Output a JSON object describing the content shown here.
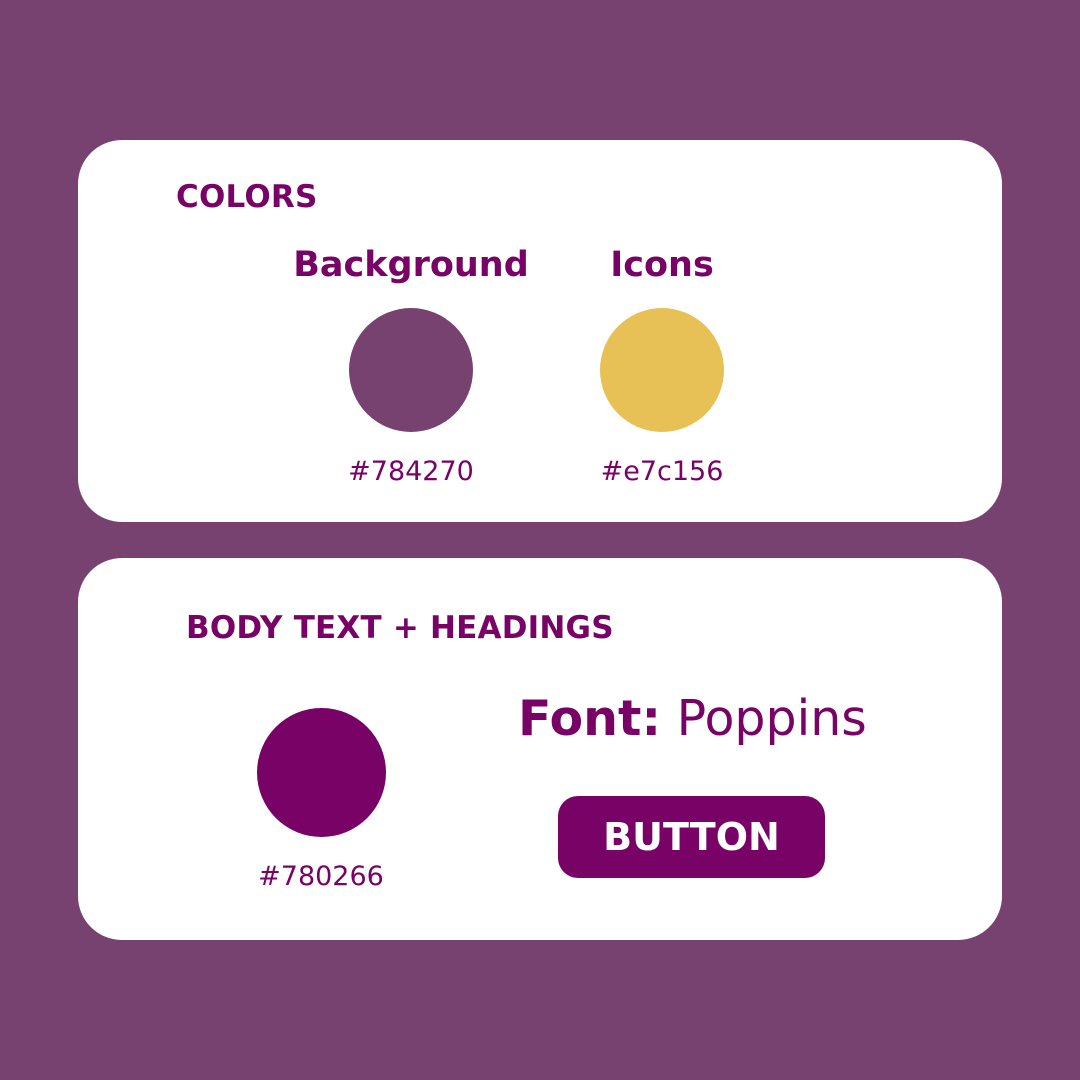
{
  "colors": {
    "title": "COLORS",
    "swatches": [
      {
        "label": "Background",
        "hex": "#784270",
        "color": "#784270"
      },
      {
        "label": "Icons",
        "hex": "#e7c156",
        "color": "#e7c156"
      }
    ]
  },
  "typography": {
    "title": "BODY TEXT + HEADINGS",
    "swatch": {
      "hex": "#780266",
      "color": "#780266"
    },
    "font_label": "Font:",
    "font_name": "Poppins",
    "button_label": "BUTTON"
  }
}
